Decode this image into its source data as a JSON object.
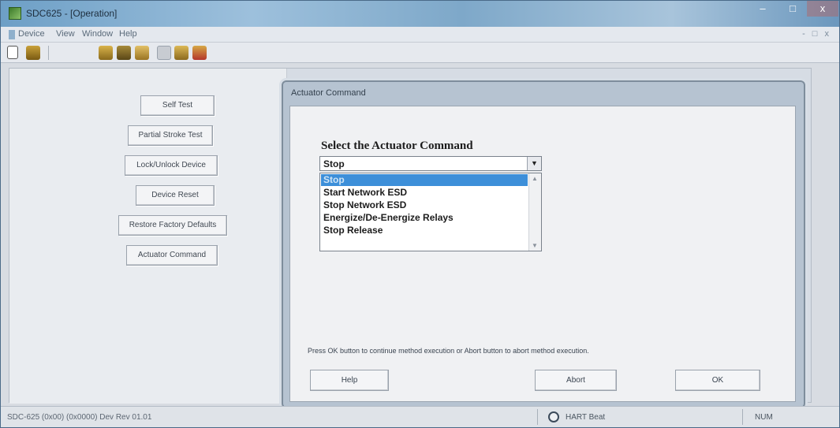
{
  "window": {
    "title": "SDC625 - [Operation]",
    "min_glyph": "–",
    "max_glyph": "□",
    "close_glyph": "x"
  },
  "menu": {
    "items": [
      "Device",
      "View",
      "Window",
      "Help"
    ],
    "mdi_controls": "- □ x"
  },
  "toolbar": {
    "icons": [
      "new-icon",
      "device-icon",
      "save-icon",
      "open-icon",
      "refresh-icon",
      "print-icon",
      "upload-icon",
      "download-icon"
    ]
  },
  "methods": {
    "buttons": [
      "Self Test",
      "Partial Stroke Test",
      "Lock/Unlock Device",
      "Device Reset",
      "Restore Factory Defaults",
      "Actuator Command"
    ]
  },
  "dialog": {
    "title": "Actuator Command",
    "label": "Select the Actuator Command",
    "selected_value": "Stop",
    "options": [
      "Stop",
      "Start Network ESD",
      "Stop Network ESD",
      "Energize/De-Energize Relays",
      "Stop Release"
    ],
    "highlighted_index": 0,
    "hint": "Press OK button to continue method execution or Abort button to abort method execution.",
    "help_label": "Help",
    "abort_label": "Abort",
    "ok_label": "OK"
  },
  "status": {
    "left_text": "SDC-625 (0x00) (0x0000) Dev Rev 01.01",
    "heartbeat_text": "HART Beat",
    "mode_text": "NUM"
  },
  "colors": {
    "selection": "#3d8fd9",
    "titlebar": "#7ea8c9"
  }
}
